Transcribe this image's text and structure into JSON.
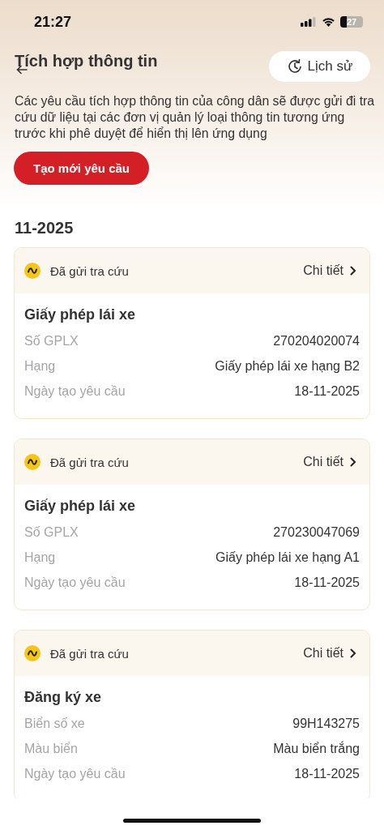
{
  "status_bar": {
    "time": "21:27",
    "battery": "27"
  },
  "header": {
    "title": "Tích hợp thông tin",
    "history_button": "Lịch sử"
  },
  "description": "Các yêu cầu tích hợp thông tin của công dân sẽ được gửi đi tra cứu dữ liệu tại các đơn vị quản lý loại thông tin tương ứng trước khi phê duyệt để hiển thị lên ứng dụng",
  "create_button": "Tạo mới yêu cầu",
  "section_title": "11-2025",
  "requests": [
    {
      "status": "Đã gửi tra cứu",
      "detail_link": "Chi tiết",
      "title": "Giấy phép lái xe",
      "fields": [
        {
          "label": "Số GPLX",
          "value": "270204020074"
        },
        {
          "label": "Hạng",
          "value": "Giấy phép lái xe hạng B2"
        },
        {
          "label": "Ngày tạo yêu cầu",
          "value": "18-11-2025"
        }
      ]
    },
    {
      "status": "Đã gửi tra cứu",
      "detail_link": "Chi tiết",
      "title": "Giấy phép lái xe",
      "fields": [
        {
          "label": "Số GPLX",
          "value": "270230047069"
        },
        {
          "label": "Hạng",
          "value": "Giấy phép lái xe hạng A1"
        },
        {
          "label": "Ngày tạo yêu cầu",
          "value": "18-11-2025"
        }
      ]
    },
    {
      "status": "Đã gửi tra cứu",
      "detail_link": "Chi tiết",
      "title": "Đăng ký xe",
      "fields": [
        {
          "label": "Biển số xe",
          "value": "99H143275"
        },
        {
          "label": "Màu biển",
          "value": "Màu biển trắng"
        },
        {
          "label": "Ngày tạo yêu cầu",
          "value": "18-11-2025"
        }
      ]
    }
  ]
}
